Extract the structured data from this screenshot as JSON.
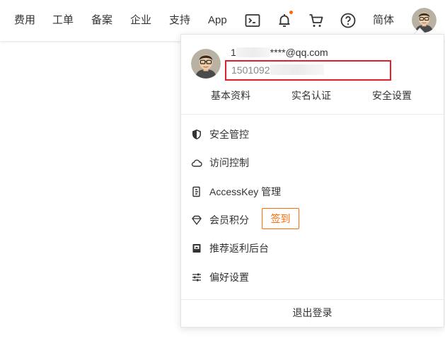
{
  "topnav": {
    "items": [
      {
        "label": "费用"
      },
      {
        "label": "工单"
      },
      {
        "label": "备案"
      },
      {
        "label": "企业"
      },
      {
        "label": "支持"
      },
      {
        "label": "App"
      }
    ],
    "icons": [
      "terminal-icon",
      "bell-icon",
      "cart-icon",
      "help-icon"
    ],
    "language": "简体"
  },
  "account": {
    "email_prefix": "1",
    "email_suffix": "****@qq.com",
    "phone_prefix": "1501092",
    "links": [
      {
        "label": "基本资料"
      },
      {
        "label": "实名认证"
      },
      {
        "label": "安全设置"
      }
    ]
  },
  "menu": {
    "items": [
      {
        "label": "安全管控",
        "icon": "shield-icon"
      },
      {
        "label": "访问控制",
        "icon": "cloud-icon"
      },
      {
        "label": "AccessKey 管理",
        "icon": "key-icon"
      },
      {
        "label": "会员积分",
        "icon": "diamond-icon"
      },
      {
        "label": "推荐返利后台",
        "icon": "rebate-icon"
      },
      {
        "label": "偏好设置",
        "icon": "sliders-icon"
      }
    ],
    "checkin_label": "签到"
  },
  "logout_label": "退出登录",
  "colors": {
    "accent": "#ff6a00",
    "highlight_box": "#e0202a",
    "text": "#333333"
  }
}
